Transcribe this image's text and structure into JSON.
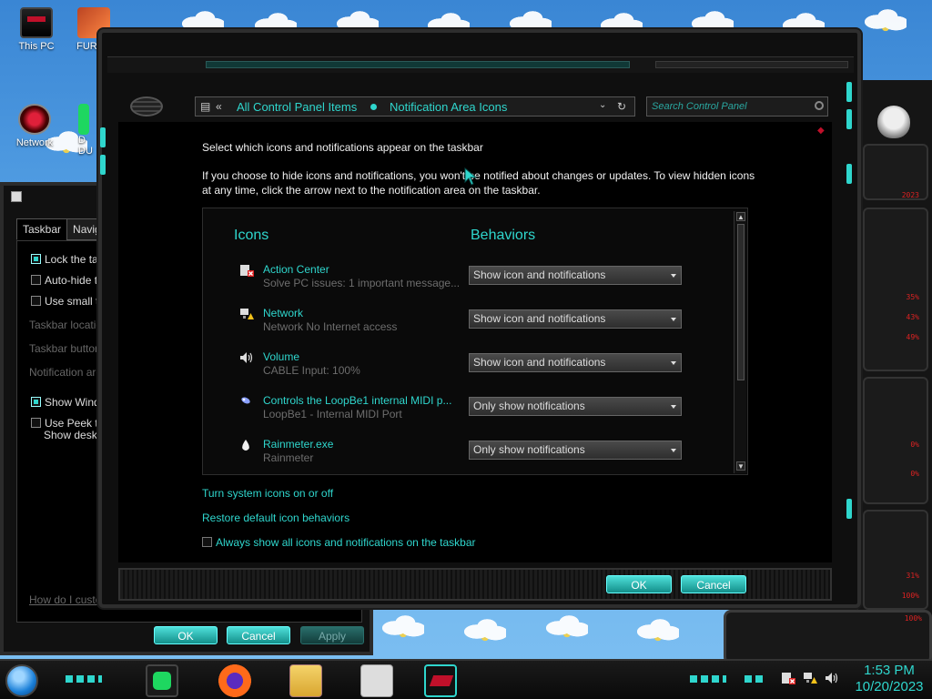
{
  "desktop": {
    "icons": [
      {
        "label": "This PC"
      },
      {
        "label": "FURRY"
      },
      {
        "label": "Network"
      },
      {
        "label": "D"
      },
      {
        "label": "DU"
      }
    ]
  },
  "taskbar_properties": {
    "tabs": [
      {
        "label": "Taskbar"
      },
      {
        "label": "Navigati"
      }
    ],
    "options": {
      "lock": "Lock the taskb",
      "autohide": "Auto-hide the",
      "small": "Use small taskl",
      "location": "Taskbar location",
      "buttons": "Taskbar buttons:",
      "notif_area": "Notification area:",
      "show_windows": "Show Windows",
      "peek1": "Use Peek to pr",
      "peek2": "Show desktop"
    },
    "help_link": "How do I custom",
    "ok": "OK",
    "cancel": "Cancel",
    "apply": "Apply"
  },
  "control_panel": {
    "breadcrumb": [
      "All Control Panel Items",
      "Notification Area Icons"
    ],
    "search_placeholder": "Search Control Panel",
    "heading": "Select which icons and notifications appear on the taskbar",
    "description": "If you choose to hide icons and notifications, you won't be notified about changes or updates. To view hidden icons at any time, click the arrow next to the notification area on the taskbar.",
    "col_icons": "Icons",
    "col_behaviors": "Behaviors",
    "items": [
      {
        "name": "Action Center",
        "sub": "Solve PC issues: 1 important message...",
        "behavior": "Show icon and notifications"
      },
      {
        "name": "Network",
        "sub": "Network No Internet access",
        "behavior": "Show icon and notifications"
      },
      {
        "name": "Volume",
        "sub": "CABLE Input: 100%",
        "behavior": "Show icon and notifications"
      },
      {
        "name": "Controls the LoopBe1 internal MIDI p...",
        "sub": "LoopBe1 - Internal MIDI Port",
        "behavior": "Only show notifications"
      },
      {
        "name": "Rainmeter.exe",
        "sub": "Rainmeter",
        "behavior": "Only show notifications"
      }
    ],
    "link_system_icons": "Turn system icons on or off",
    "link_restore": "Restore default icon behaviors",
    "always_show": "Always show all icons and notifications on the taskbar",
    "ok": "OK",
    "cancel": "Cancel"
  },
  "gadgets": {
    "readouts": [
      "2023",
      "35%",
      "43%",
      "49%",
      "0%",
      "0%",
      "31%",
      "100%",
      "100%"
    ]
  },
  "clock": {
    "time": "1:53 PM",
    "date": "10/20/2023"
  },
  "colors": {
    "accent": "#2fd6cd",
    "window_bg": "#000000",
    "gadget_red": "#dd2222"
  }
}
